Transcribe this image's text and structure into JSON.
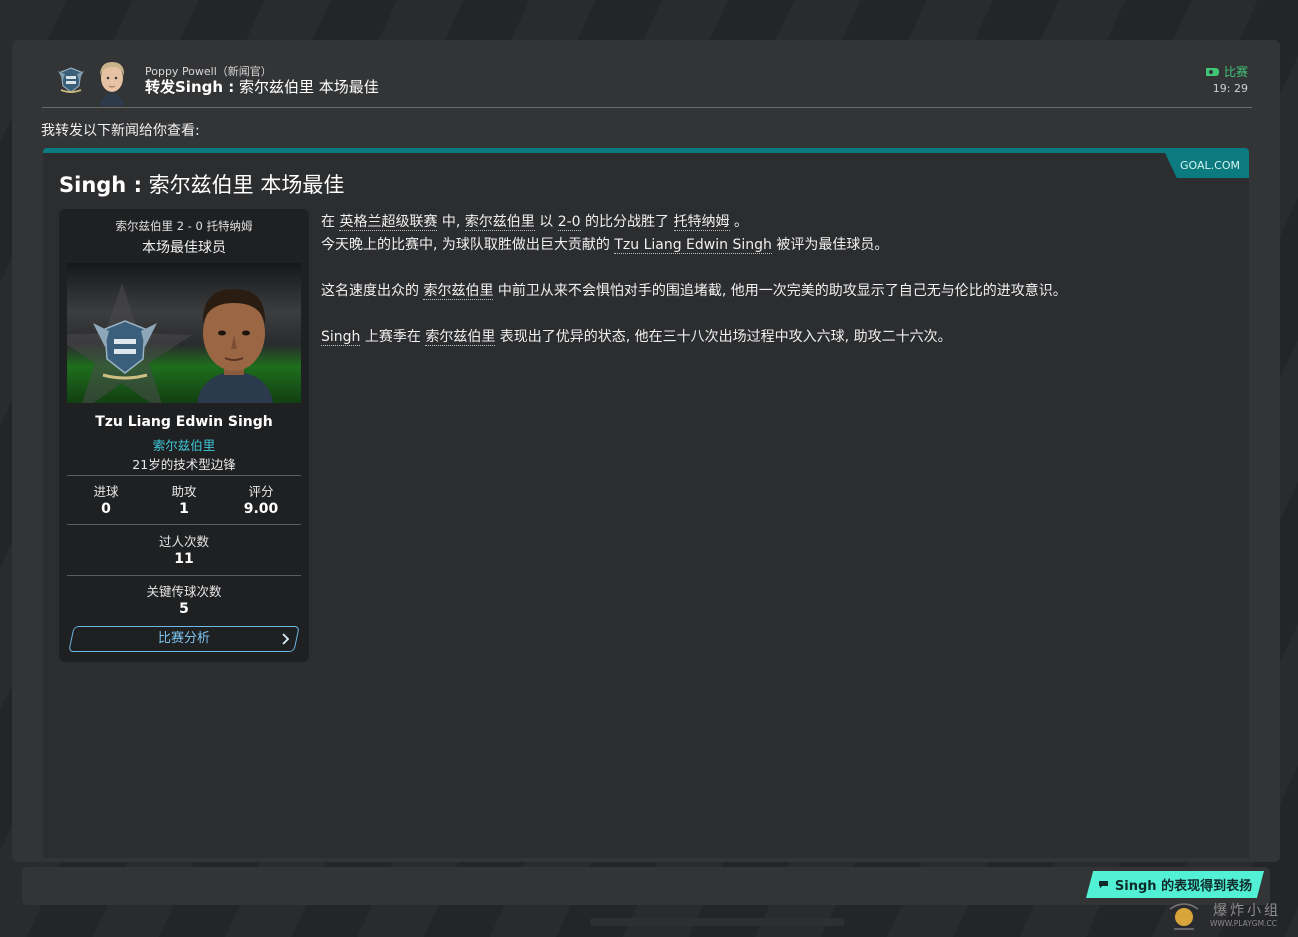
{
  "message": {
    "sender": "Poppy Powell（新闻官）",
    "subject_bold": "转发Singh :",
    "subject_rest": " 索尔兹伯里 本场最佳",
    "category": "比赛",
    "time": "19: 29",
    "intro": "我转发以下新闻给你查看:"
  },
  "article": {
    "source": "GOAL.COM",
    "headline_bold": "Singh :",
    "headline_rest": " 索尔兹伯里 本场最佳",
    "paragraphs": {
      "p1_a": "在 ",
      "p1_league": "英格兰超级联赛",
      "p1_b": " 中, ",
      "p1_club": "索尔兹伯里",
      "p1_c": " 以 ",
      "p1_score": "2-0",
      "p1_d": " 的比分战胜了 ",
      "p1_opp": "托特纳姆",
      "p1_e": " 。",
      "p2_a": "今天晚上的比赛中, 为球队取胜做出巨大贡献的 ",
      "p2_player": "Tzu Liang Edwin Singh",
      "p2_b": " 被评为最佳球员。",
      "p3_a": "这名速度出众的 ",
      "p3_club": "索尔兹伯里",
      "p3_b": " 中前卫从来不会惧怕对手的围追堵截, 他用一次完美的助攻显示了自己无与伦比的进攻意识。",
      "p4_player": "Singh",
      "p4_a": " 上赛季在 ",
      "p4_club": "索尔兹伯里",
      "p4_b": " 表现出了优异的状态, 他在三十八次出场过程中攻入六球, 助攻二十六次。"
    }
  },
  "card": {
    "match_result": "索尔兹伯里 2 - 0 托特纳姆",
    "award": "本场最佳球员",
    "player_name": "Tzu Liang Edwin Singh",
    "club": "索尔兹伯里",
    "role": "21岁的技术型边锋",
    "stats": {
      "goals_label": "进球",
      "goals": "0",
      "assists_label": "助攻",
      "assists": "1",
      "rating_label": "评分",
      "rating": "9.00",
      "dribbles_label": "过人次数",
      "dribbles": "11",
      "key_passes_label": "关键传球次数",
      "key_passes": "5"
    },
    "analysis_button": "比赛分析"
  },
  "reply": {
    "button": "Singh 的表现得到表扬"
  },
  "watermark": {
    "text": "爆炸小组",
    "url": "WWW.PLAYGM.CC"
  },
  "colors": {
    "accent_teal": "#0b7b7f",
    "club_cyan": "#3fc7d6",
    "category_green": "#41c579",
    "reply_mint": "#52f0d4",
    "link_blue": "#7cc4ee"
  }
}
